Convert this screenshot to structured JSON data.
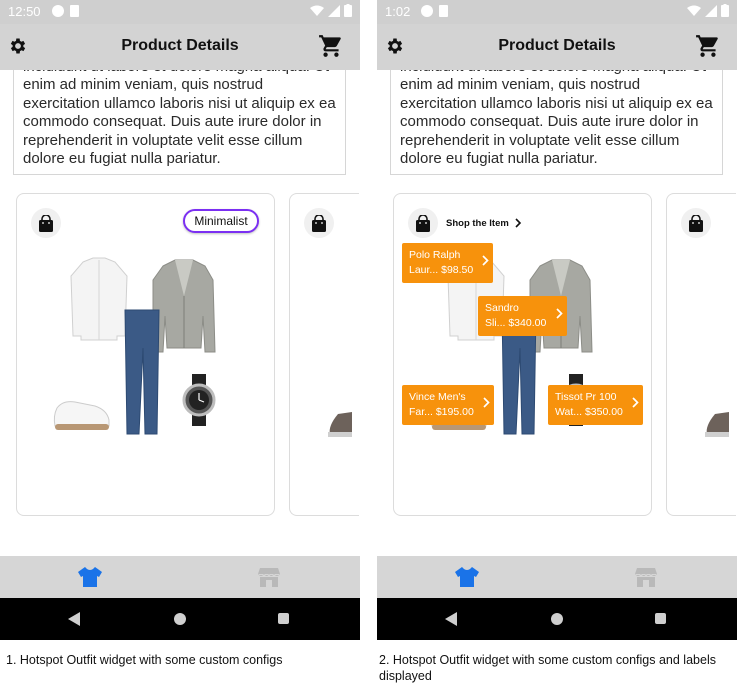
{
  "screens": [
    {
      "status_time": "12:50",
      "title": "Product Details",
      "description": "incididunt ut labore et dolore magna aliqua. Ut enim ad minim veniam, quis nostrud exercitation ullamco laboris nisi ut aliquip ex ea commodo consequat. Duis aute irure dolor in reprehenderit in voluptate velit esse cillum dolore eu fugiat nulla pariatur.",
      "style_chip": "Minimalist",
      "active_tab_color": "#1a73e8"
    },
    {
      "status_time": "1:02",
      "title": "Product Details",
      "description": "incididunt ut labore et dolore magna aliqua. Ut enim ad minim veniam, quis nostrud exercitation ullamco laboris nisi ut aliquip ex ea commodo consequat. Duis aute irure dolor in reprehenderit in voluptate velit esse cillum dolore eu fugiat nulla pariatur.",
      "shop_label": "Shop the Item",
      "hotspots": [
        {
          "name": "Polo Ralph",
          "detail": "Laur... $98.50"
        },
        {
          "name": "Sandro",
          "detail": "Sli... $340.00"
        },
        {
          "name": "Vince Men's",
          "detail": "Far... $195.00"
        },
        {
          "name": "Tissot Pr 100",
          "detail": "Wat... $350.00"
        }
      ],
      "hotspot_color": "#f7920c"
    }
  ],
  "icons": {
    "settings": "gear-icon",
    "cart": "cart-icon",
    "bag": "shopping-bag-icon",
    "outfit_tab": "tshirt-icon",
    "store_tab": "store-icon"
  },
  "captions": [
    "1. Hotspot Outfit widget with some custom configs",
    "2. Hotspot Outfit widget with some custom configs and labels displayed"
  ]
}
